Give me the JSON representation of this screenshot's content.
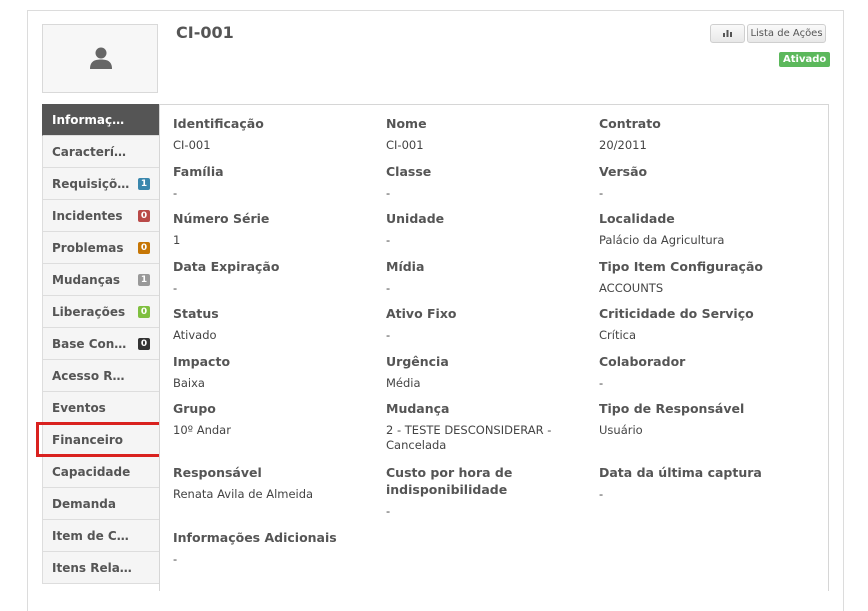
{
  "header": {
    "title": "CI-001",
    "actions_label": "Lista de Ações",
    "status_badge": "Ativado"
  },
  "sidebar": {
    "items": [
      {
        "label": "Informaçõe...",
        "active": true
      },
      {
        "label": "Característi..."
      },
      {
        "label": "Requisições",
        "count": "1",
        "color": "#3a87ad"
      },
      {
        "label": "Incidentes",
        "count": "0",
        "color": "#b94a48"
      },
      {
        "label": "Problemas",
        "count": "0",
        "color": "#c67605"
      },
      {
        "label": "Mudanças",
        "count": "1",
        "color": "#999999"
      },
      {
        "label": "Liberações",
        "count": "0",
        "color": "#7fbf3f"
      },
      {
        "label": "Base Conhe...",
        "count": "0",
        "color": "#333333"
      },
      {
        "label": "Acesso Rem..."
      },
      {
        "label": "Eventos"
      },
      {
        "label": "Financeiro",
        "highlighted": true
      },
      {
        "label": "Capacidade"
      },
      {
        "label": "Demanda"
      },
      {
        "label": "Item de Co..."
      },
      {
        "label": "Itens Relaci..."
      }
    ]
  },
  "details": {
    "identificacao": {
      "label": "Identificação",
      "value": "CI-001"
    },
    "nome": {
      "label": "Nome",
      "value": "CI-001"
    },
    "contrato": {
      "label": "Contrato",
      "value": "20/2011"
    },
    "familia": {
      "label": "Família",
      "value": "-"
    },
    "classe": {
      "label": "Classe",
      "value": "-"
    },
    "versao": {
      "label": "Versão",
      "value": "-"
    },
    "numero_serie": {
      "label": "Número Série",
      "value": "1"
    },
    "unidade": {
      "label": "Unidade",
      "value": "-"
    },
    "localidade": {
      "label": "Localidade",
      "value": "Palácio da Agricultura"
    },
    "data_expiracao": {
      "label": "Data Expiração",
      "value": "-"
    },
    "midia": {
      "label": "Mídia",
      "value": "-"
    },
    "tipo_item": {
      "label": "Tipo Item Configuração",
      "value": "ACCOUNTS"
    },
    "status": {
      "label": "Status",
      "value": "Ativado"
    },
    "ativo_fixo": {
      "label": "Ativo Fixo",
      "value": "-"
    },
    "criticidade": {
      "label": "Criticidade do Serviço",
      "value": "Crítica"
    },
    "impacto": {
      "label": "Impacto",
      "value": "Baixa"
    },
    "urgencia": {
      "label": "Urgência",
      "value": "Média"
    },
    "colaborador": {
      "label": "Colaborador",
      "value": "-"
    },
    "grupo": {
      "label": "Grupo",
      "value": "10º Andar"
    },
    "mudanca": {
      "label": "Mudança",
      "value": "2 - TESTE DESCONSIDERAR - Cancelada"
    },
    "tipo_responsavel": {
      "label": "Tipo de Responsável",
      "value": "Usuário"
    },
    "responsavel": {
      "label": "Responsável",
      "value": "Renata Avila de Almeida"
    },
    "custo_hora": {
      "label": "Custo por hora de indisponibilidade",
      "value": "-"
    },
    "data_captura": {
      "label": "Data da última captura",
      "value": "-"
    },
    "info_adicionais": {
      "label": "Informações Adicionais",
      "value": "-"
    }
  }
}
